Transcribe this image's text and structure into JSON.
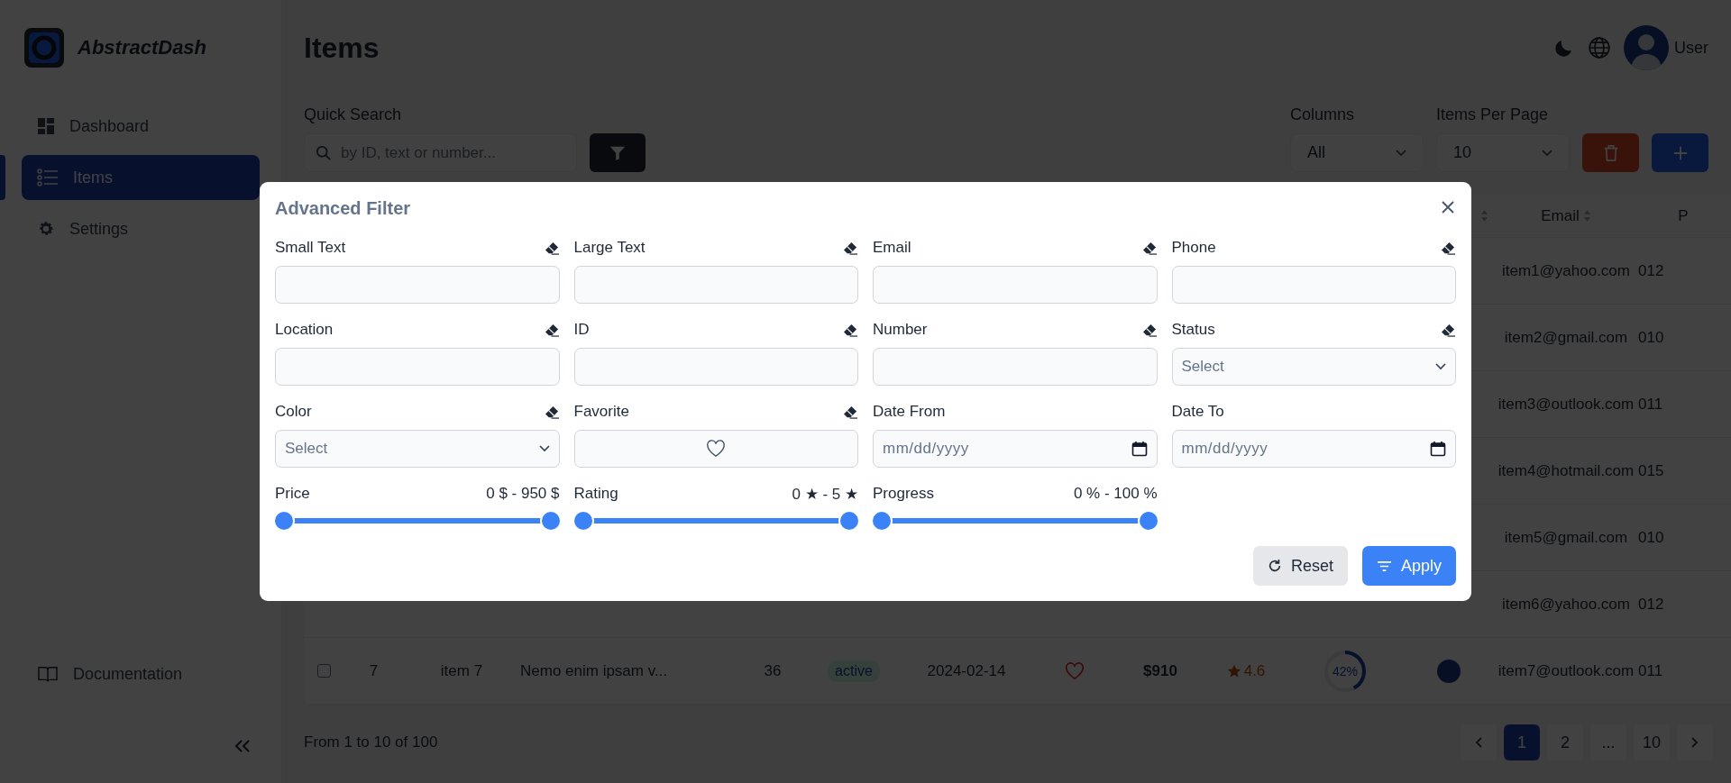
{
  "sidebar": {
    "brand": "AbstractDash",
    "items": [
      {
        "label": "Dashboard",
        "selected": false
      },
      {
        "label": "Items",
        "selected": true
      },
      {
        "label": "Settings",
        "selected": false
      }
    ],
    "footer_link": "Documentation"
  },
  "header": {
    "title": "Items",
    "user": "User"
  },
  "toolbar": {
    "quick_search": {
      "label": "Quick Search",
      "placeholder": "by ID, text or number..."
    },
    "columns": {
      "label": "Columns",
      "value": "All"
    },
    "items_per_page": {
      "label": "Items Per Page",
      "value": "10"
    }
  },
  "table": {
    "columns": [
      {
        "sortable": true
      },
      {
        "label": "Email",
        "sortable": true
      },
      {
        "label": "P"
      }
    ],
    "rows": [
      {
        "email": "item1@yahoo.com",
        "phone": "012"
      },
      {
        "email": "item2@gmail.com",
        "phone": "010"
      },
      {
        "email": "item3@outlook.com",
        "phone": "011"
      },
      {
        "email": "item4@hotmail.com",
        "phone": "015"
      },
      {
        "email": "item5@gmail.com",
        "phone": "010"
      },
      {
        "email": "item6@yahoo.com",
        "phone": "012"
      },
      {
        "checked": false,
        "id": "7",
        "name": "item 7",
        "text": "Nemo enim ipsam v...",
        "number": "36",
        "status": "active",
        "date": "2024-02-14",
        "favorite": false,
        "price": "$910",
        "rating": "4.6",
        "progress": {
          "level": 0.42,
          "label": "42%"
        },
        "email": "item7@outlook.com",
        "phone": "011"
      }
    ]
  },
  "pagination": {
    "summary": "From 1 to 10 of 100",
    "pages": [
      {
        "label": "1",
        "selected": true
      },
      {
        "label": "2",
        "selected": false
      },
      {
        "label": "...",
        "selected": false
      },
      {
        "label": "10",
        "selected": false
      }
    ]
  },
  "modal": {
    "title": "Advanced Filter",
    "filters": [
      {
        "label": "Small Text",
        "kind": "text",
        "clearable": true
      },
      {
        "label": "Large Text",
        "kind": "text",
        "clearable": true
      },
      {
        "label": "Email",
        "kind": "text",
        "clearable": true
      },
      {
        "label": "Phone",
        "kind": "text",
        "clearable": true
      },
      {
        "label": "Location",
        "kind": "text",
        "clearable": true
      },
      {
        "label": "ID",
        "kind": "text",
        "clearable": true
      },
      {
        "label": "Number",
        "kind": "text",
        "clearable": true
      },
      {
        "label": "Status",
        "kind": "select",
        "placeholder": "Select",
        "clearable": true
      },
      {
        "label": "Color",
        "kind": "select",
        "placeholder": "Select",
        "clearable": true
      },
      {
        "label": "Favorite",
        "kind": "favorite",
        "favorite": false,
        "clearable": true
      },
      {
        "label": "Date From",
        "kind": "date",
        "placeholder": "mm/dd/yyyy"
      },
      {
        "label": "Date To",
        "kind": "date",
        "placeholder": "mm/dd/yyyy"
      },
      {
        "label": "Price",
        "kind": "range",
        "range": "0 $ - 950 $",
        "level": 1
      },
      {
        "label": "Rating",
        "kind": "range",
        "range": "0 ★ - 5 ★",
        "level": 1
      },
      {
        "label": "Progress",
        "kind": "range",
        "range": "0 % - 100 %",
        "level": 1
      }
    ],
    "buttons": [
      {
        "label": "Reset",
        "kind": "secondary"
      },
      {
        "label": "Apply",
        "kind": "primary"
      }
    ]
  }
}
